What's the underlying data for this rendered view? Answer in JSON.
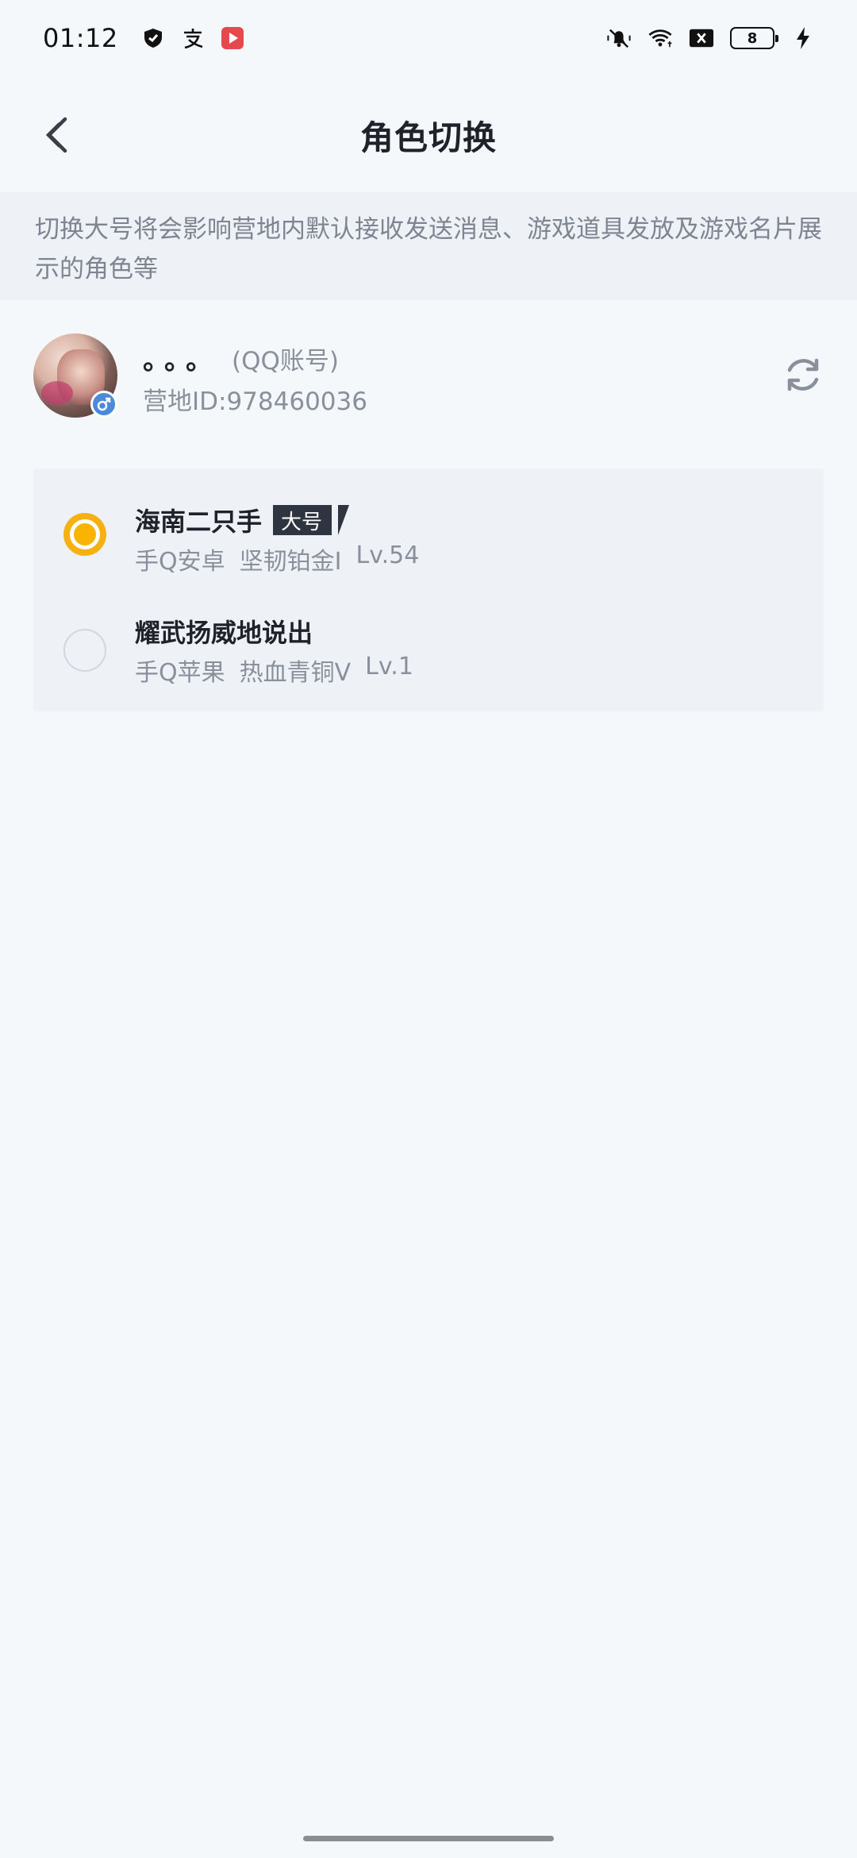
{
  "status_bar": {
    "time": "01:12",
    "left_icons": [
      "shield-icon",
      "alipay-icon",
      "video-app-icon"
    ],
    "right_icons": [
      "mute-icon",
      "wifi-icon",
      "no-sim-icon",
      "battery-icon",
      "charging-icon"
    ],
    "battery_level": "8"
  },
  "header": {
    "title": "角色切换"
  },
  "notice": {
    "text": "切换大号将会影响营地内默认接收发送消息、游戏道具发放及游戏名片展示的角色等"
  },
  "account": {
    "name": "。。。",
    "type": "(QQ账号)",
    "camp_id": "营地ID:978460036",
    "gender_color": "#4b8ad8"
  },
  "roles": [
    {
      "name": "海南二只手",
      "tag": "大号",
      "platform": "手Q安卓",
      "rank": "坚韧铂金I",
      "level": "Lv.54",
      "selected": true
    },
    {
      "name": "耀武扬威地说出",
      "tag": "",
      "platform": "手Q苹果",
      "rank": "热血青铜V",
      "level": "Lv.1",
      "selected": false
    }
  ],
  "colors": {
    "accent": "#f8b400",
    "background": "#f5f8fb",
    "card": "#eef1f5"
  }
}
